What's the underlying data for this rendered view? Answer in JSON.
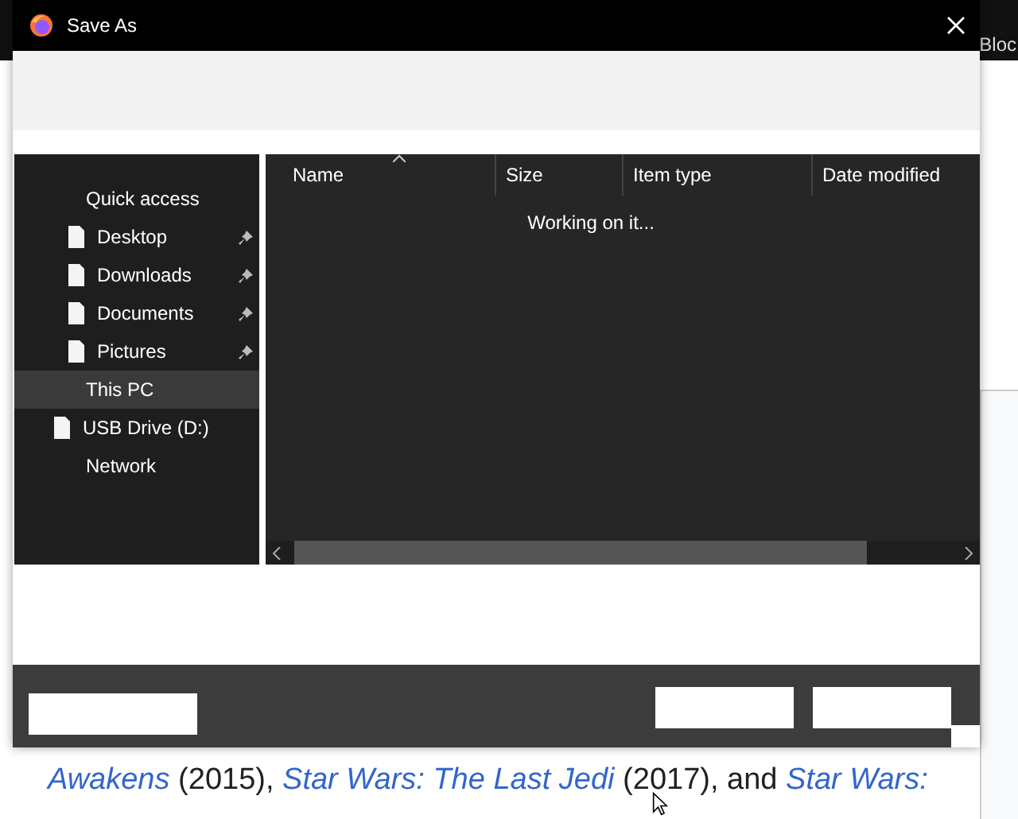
{
  "background_page": {
    "header_text": "Bloc",
    "paragraph": [
      {
        "text": "Awakens",
        "kind": "link"
      },
      {
        "text": " (2015), ",
        "kind": "plain"
      },
      {
        "text": "Star Wars: The Last Jedi",
        "kind": "link"
      },
      {
        "text": " (2017), and ",
        "kind": "plain"
      },
      {
        "text": "Star Wars:",
        "kind": "link"
      }
    ]
  },
  "dialog": {
    "title": "Save As",
    "sidebar": {
      "items": [
        {
          "label": "Quick access",
          "kind": "header",
          "selected": false
        },
        {
          "label": "Desktop",
          "kind": "pinned",
          "selected": false
        },
        {
          "label": "Downloads",
          "kind": "pinned",
          "selected": false
        },
        {
          "label": "Documents",
          "kind": "pinned",
          "selected": false
        },
        {
          "label": "Pictures",
          "kind": "pinned",
          "selected": false
        },
        {
          "label": "This PC",
          "kind": "header",
          "selected": true
        },
        {
          "label": "USB Drive (D:)",
          "kind": "drive",
          "selected": false
        },
        {
          "label": "Network",
          "kind": "header",
          "selected": false
        }
      ]
    },
    "file_list": {
      "columns": [
        "Name",
        "Size",
        "Item type",
        "Date modified"
      ],
      "status": "Working on it..."
    }
  }
}
